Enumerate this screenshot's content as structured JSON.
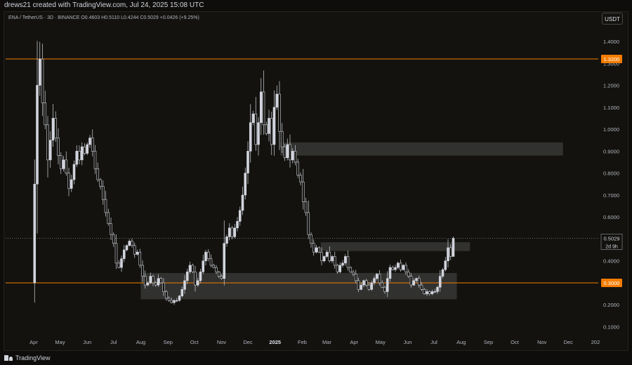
{
  "header": {
    "attribution": "drews21 created with TradingView.com, Jul 24, 2025 15:08 UTC"
  },
  "legend": {
    "symbol": "ENA / TetherUS · 3D · BINANCE",
    "open": "O0.4603",
    "high": "H0.5110",
    "low": "L0.4244",
    "close": "C0.5029",
    "change": "+0.0426 (+9.25%)"
  },
  "currency_button": "USDT",
  "footer": {
    "logo": "TradingView"
  },
  "colors": {
    "candle": "#d1d4dc",
    "level_line": "#f57c00",
    "zone": "#3a3936",
    "price_line": "#9598a1",
    "grid_text": "#b2b5be"
  },
  "chart_data": {
    "type": "candlestick",
    "y_axis": {
      "ticks": [
        1.4,
        1.3,
        1.2,
        1.1,
        1.0,
        0.9,
        0.8,
        0.7,
        0.6,
        0.5,
        0.4,
        0.3,
        0.2,
        0.1
      ],
      "tick_labels": [
        "1.4000",
        "1.3000",
        "1.2000",
        "1.1000",
        "1.0000",
        "0.9000",
        "0.8000",
        "0.7000",
        "0.6000",
        "0.5000",
        "0.4000",
        "0.3000",
        "0.2000",
        "0.1000"
      ],
      "range": [
        0.06,
        1.48
      ]
    },
    "x_axis": {
      "range": [
        "2024-04-01",
        "2026-01-01"
      ],
      "ticks": [
        {
          "date": "2024-04-01",
          "label": "Apr"
        },
        {
          "date": "2024-05-01",
          "label": "May"
        },
        {
          "date": "2024-06-01",
          "label": "Jun"
        },
        {
          "date": "2024-07-01",
          "label": "Jul"
        },
        {
          "date": "2024-08-01",
          "label": "Aug"
        },
        {
          "date": "2024-09-01",
          "label": "Sep"
        },
        {
          "date": "2024-10-01",
          "label": "Oct"
        },
        {
          "date": "2024-11-01",
          "label": "Nov"
        },
        {
          "date": "2024-12-01",
          "label": "Dec"
        },
        {
          "date": "2025-01-01",
          "label": "2025"
        },
        {
          "date": "2025-02-01",
          "label": "Feb"
        },
        {
          "date": "2025-03-01",
          "label": "Mar"
        },
        {
          "date": "2025-04-01",
          "label": "Apr"
        },
        {
          "date": "2025-05-01",
          "label": "May"
        },
        {
          "date": "2025-06-01",
          "label": "Jun"
        },
        {
          "date": "2025-07-01",
          "label": "Jul"
        },
        {
          "date": "2025-08-01",
          "label": "Aug"
        },
        {
          "date": "2025-09-01",
          "label": "Sep"
        },
        {
          "date": "2025-10-01",
          "label": "Oct"
        },
        {
          "date": "2025-11-01",
          "label": "Nov"
        },
        {
          "date": "2025-12-01",
          "label": "Dec"
        },
        {
          "date": "2026-01-01",
          "label": "202"
        }
      ]
    },
    "horizontal_levels": [
      {
        "value": 1.32,
        "label": "1.3200",
        "color": "#f57c00"
      },
      {
        "value": 0.3,
        "label": "0.3000",
        "color": "#f57c00"
      }
    ],
    "current_price": {
      "value": 0.5029,
      "label": "0.5029",
      "countdown": "2d 9h"
    },
    "zones": [
      {
        "from": "2025-01-07",
        "to": "2025-11-25",
        "low": 0.88,
        "high": 0.94
      },
      {
        "from": "2025-02-22",
        "to": "2025-08-11",
        "low": 0.445,
        "high": 0.485
      },
      {
        "from": "2024-08-01",
        "to": "2025-07-27",
        "low": 0.225,
        "high": 0.345
      }
    ],
    "closes": [
      {
        "date": "2024-04-02",
        "value": 0.75
      },
      {
        "date": "2024-04-05",
        "value": 1.2
      },
      {
        "date": "2024-04-08",
        "value": 1.32
      },
      {
        "date": "2024-04-11",
        "value": 1.12
      },
      {
        "date": "2024-04-14",
        "value": 1.02
      },
      {
        "date": "2024-04-17",
        "value": 0.86
      },
      {
        "date": "2024-04-20",
        "value": 0.95
      },
      {
        "date": "2024-04-23",
        "value": 1.05
      },
      {
        "date": "2024-04-26",
        "value": 0.96
      },
      {
        "date": "2024-04-29",
        "value": 0.88
      },
      {
        "date": "2024-05-02",
        "value": 0.82
      },
      {
        "date": "2024-05-05",
        "value": 0.86
      },
      {
        "date": "2024-05-08",
        "value": 0.8
      },
      {
        "date": "2024-05-11",
        "value": 0.73
      },
      {
        "date": "2024-05-14",
        "value": 0.77
      },
      {
        "date": "2024-05-17",
        "value": 0.84
      },
      {
        "date": "2024-05-20",
        "value": 0.9
      },
      {
        "date": "2024-05-23",
        "value": 0.86
      },
      {
        "date": "2024-05-26",
        "value": 0.92
      },
      {
        "date": "2024-05-29",
        "value": 0.89
      },
      {
        "date": "2024-06-01",
        "value": 0.93
      },
      {
        "date": "2024-06-04",
        "value": 0.96
      },
      {
        "date": "2024-06-07",
        "value": 0.9
      },
      {
        "date": "2024-06-10",
        "value": 0.82
      },
      {
        "date": "2024-06-13",
        "value": 0.77
      },
      {
        "date": "2024-06-16",
        "value": 0.74
      },
      {
        "date": "2024-06-19",
        "value": 0.68
      },
      {
        "date": "2024-06-22",
        "value": 0.62
      },
      {
        "date": "2024-06-25",
        "value": 0.57
      },
      {
        "date": "2024-06-28",
        "value": 0.52
      },
      {
        "date": "2024-07-01",
        "value": 0.48
      },
      {
        "date": "2024-07-04",
        "value": 0.39
      },
      {
        "date": "2024-07-07",
        "value": 0.37
      },
      {
        "date": "2024-07-10",
        "value": 0.41
      },
      {
        "date": "2024-07-13",
        "value": 0.45
      },
      {
        "date": "2024-07-16",
        "value": 0.47
      },
      {
        "date": "2024-07-19",
        "value": 0.49
      },
      {
        "date": "2024-07-22",
        "value": 0.47
      },
      {
        "date": "2024-07-25",
        "value": 0.43
      },
      {
        "date": "2024-07-28",
        "value": 0.44
      },
      {
        "date": "2024-07-31",
        "value": 0.38
      },
      {
        "date": "2024-08-03",
        "value": 0.33
      },
      {
        "date": "2024-08-06",
        "value": 0.29
      },
      {
        "date": "2024-08-09",
        "value": 0.3
      },
      {
        "date": "2024-08-12",
        "value": 0.33
      },
      {
        "date": "2024-08-15",
        "value": 0.3
      },
      {
        "date": "2024-08-18",
        "value": 0.29
      },
      {
        "date": "2024-08-21",
        "value": 0.32
      },
      {
        "date": "2024-08-24",
        "value": 0.3
      },
      {
        "date": "2024-08-27",
        "value": 0.26
      },
      {
        "date": "2024-08-30",
        "value": 0.23
      },
      {
        "date": "2024-09-02",
        "value": 0.22
      },
      {
        "date": "2024-09-05",
        "value": 0.21
      },
      {
        "date": "2024-09-08",
        "value": 0.22
      },
      {
        "date": "2024-09-11",
        "value": 0.22
      },
      {
        "date": "2024-09-14",
        "value": 0.24
      },
      {
        "date": "2024-09-17",
        "value": 0.27
      },
      {
        "date": "2024-09-20",
        "value": 0.31
      },
      {
        "date": "2024-09-23",
        "value": 0.35
      },
      {
        "date": "2024-09-26",
        "value": 0.38
      },
      {
        "date": "2024-09-29",
        "value": 0.35
      },
      {
        "date": "2024-10-02",
        "value": 0.29
      },
      {
        "date": "2024-10-05",
        "value": 0.31
      },
      {
        "date": "2024-10-08",
        "value": 0.35
      },
      {
        "date": "2024-10-11",
        "value": 0.4
      },
      {
        "date": "2024-10-14",
        "value": 0.44
      },
      {
        "date": "2024-10-17",
        "value": 0.41
      },
      {
        "date": "2024-10-20",
        "value": 0.38
      },
      {
        "date": "2024-10-23",
        "value": 0.37
      },
      {
        "date": "2024-10-26",
        "value": 0.35
      },
      {
        "date": "2024-10-29",
        "value": 0.33
      },
      {
        "date": "2024-11-01",
        "value": 0.32
      },
      {
        "date": "2024-11-04",
        "value": 0.48
      },
      {
        "date": "2024-11-07",
        "value": 0.51
      },
      {
        "date": "2024-11-10",
        "value": 0.55
      },
      {
        "date": "2024-11-13",
        "value": 0.51
      },
      {
        "date": "2024-11-16",
        "value": 0.55
      },
      {
        "date": "2024-11-19",
        "value": 0.58
      },
      {
        "date": "2024-11-22",
        "value": 0.63
      },
      {
        "date": "2024-11-25",
        "value": 0.7
      },
      {
        "date": "2024-11-28",
        "value": 0.8
      },
      {
        "date": "2024-12-01",
        "value": 0.9
      },
      {
        "date": "2024-12-04",
        "value": 1.03
      },
      {
        "date": "2024-12-07",
        "value": 1.07
      },
      {
        "date": "2024-12-10",
        "value": 0.93
      },
      {
        "date": "2024-12-13",
        "value": 1.03
      },
      {
        "date": "2024-12-16",
        "value": 1.17
      },
      {
        "date": "2024-12-19",
        "value": 1.02
      },
      {
        "date": "2024-12-22",
        "value": 0.98
      },
      {
        "date": "2024-12-25",
        "value": 1.05
      },
      {
        "date": "2024-12-28",
        "value": 0.93
      },
      {
        "date": "2024-12-31",
        "value": 1.1
      },
      {
        "date": "2025-01-03",
        "value": 1.16
      },
      {
        "date": "2025-01-06",
        "value": 0.99
      },
      {
        "date": "2025-01-09",
        "value": 0.92
      },
      {
        "date": "2025-01-12",
        "value": 0.87
      },
      {
        "date": "2025-01-15",
        "value": 0.93
      },
      {
        "date": "2025-01-18",
        "value": 0.86
      },
      {
        "date": "2025-01-21",
        "value": 0.9
      },
      {
        "date": "2025-01-24",
        "value": 0.85
      },
      {
        "date": "2025-01-27",
        "value": 0.79
      },
      {
        "date": "2025-01-30",
        "value": 0.76
      },
      {
        "date": "2025-02-02",
        "value": 0.67
      },
      {
        "date": "2025-02-05",
        "value": 0.62
      },
      {
        "date": "2025-02-08",
        "value": 0.52
      },
      {
        "date": "2025-02-11",
        "value": 0.48
      },
      {
        "date": "2025-02-14",
        "value": 0.44
      },
      {
        "date": "2025-02-17",
        "value": 0.46
      },
      {
        "date": "2025-02-20",
        "value": 0.44
      },
      {
        "date": "2025-02-23",
        "value": 0.4
      },
      {
        "date": "2025-02-26",
        "value": 0.42
      },
      {
        "date": "2025-03-01",
        "value": 0.44
      },
      {
        "date": "2025-03-04",
        "value": 0.4
      },
      {
        "date": "2025-03-07",
        "value": 0.42
      },
      {
        "date": "2025-03-10",
        "value": 0.38
      },
      {
        "date": "2025-03-13",
        "value": 0.35
      },
      {
        "date": "2025-03-16",
        "value": 0.38
      },
      {
        "date": "2025-03-19",
        "value": 0.39
      },
      {
        "date": "2025-03-22",
        "value": 0.42
      },
      {
        "date": "2025-03-25",
        "value": 0.37
      },
      {
        "date": "2025-03-28",
        "value": 0.35
      },
      {
        "date": "2025-03-31",
        "value": 0.34
      },
      {
        "date": "2025-04-03",
        "value": 0.31
      },
      {
        "date": "2025-04-06",
        "value": 0.27
      },
      {
        "date": "2025-04-09",
        "value": 0.29
      },
      {
        "date": "2025-04-12",
        "value": 0.31
      },
      {
        "date": "2025-04-15",
        "value": 0.29
      },
      {
        "date": "2025-04-18",
        "value": 0.27
      },
      {
        "date": "2025-04-21",
        "value": 0.3
      },
      {
        "date": "2025-04-24",
        "value": 0.32
      },
      {
        "date": "2025-04-27",
        "value": 0.34
      },
      {
        "date": "2025-04-30",
        "value": 0.3
      },
      {
        "date": "2025-05-03",
        "value": 0.28
      },
      {
        "date": "2025-05-06",
        "value": 0.26
      },
      {
        "date": "2025-05-09",
        "value": 0.32
      },
      {
        "date": "2025-05-12",
        "value": 0.37
      },
      {
        "date": "2025-05-15",
        "value": 0.36
      },
      {
        "date": "2025-05-18",
        "value": 0.37
      },
      {
        "date": "2025-05-21",
        "value": 0.39
      },
      {
        "date": "2025-05-24",
        "value": 0.36
      },
      {
        "date": "2025-05-27",
        "value": 0.38
      },
      {
        "date": "2025-05-30",
        "value": 0.35
      },
      {
        "date": "2025-06-02",
        "value": 0.33
      },
      {
        "date": "2025-06-05",
        "value": 0.29
      },
      {
        "date": "2025-06-08",
        "value": 0.31
      },
      {
        "date": "2025-06-11",
        "value": 0.32
      },
      {
        "date": "2025-06-14",
        "value": 0.29
      },
      {
        "date": "2025-06-17",
        "value": 0.27
      },
      {
        "date": "2025-06-20",
        "value": 0.25
      },
      {
        "date": "2025-06-23",
        "value": 0.26
      },
      {
        "date": "2025-06-26",
        "value": 0.25
      },
      {
        "date": "2025-06-29",
        "value": 0.26
      },
      {
        "date": "2025-07-02",
        "value": 0.26
      },
      {
        "date": "2025-07-05",
        "value": 0.28
      },
      {
        "date": "2025-07-08",
        "value": 0.33
      },
      {
        "date": "2025-07-11",
        "value": 0.36
      },
      {
        "date": "2025-07-14",
        "value": 0.4
      },
      {
        "date": "2025-07-17",
        "value": 0.46
      },
      {
        "date": "2025-07-20",
        "value": 0.42
      },
      {
        "date": "2025-07-23",
        "value": 0.5029
      }
    ]
  }
}
